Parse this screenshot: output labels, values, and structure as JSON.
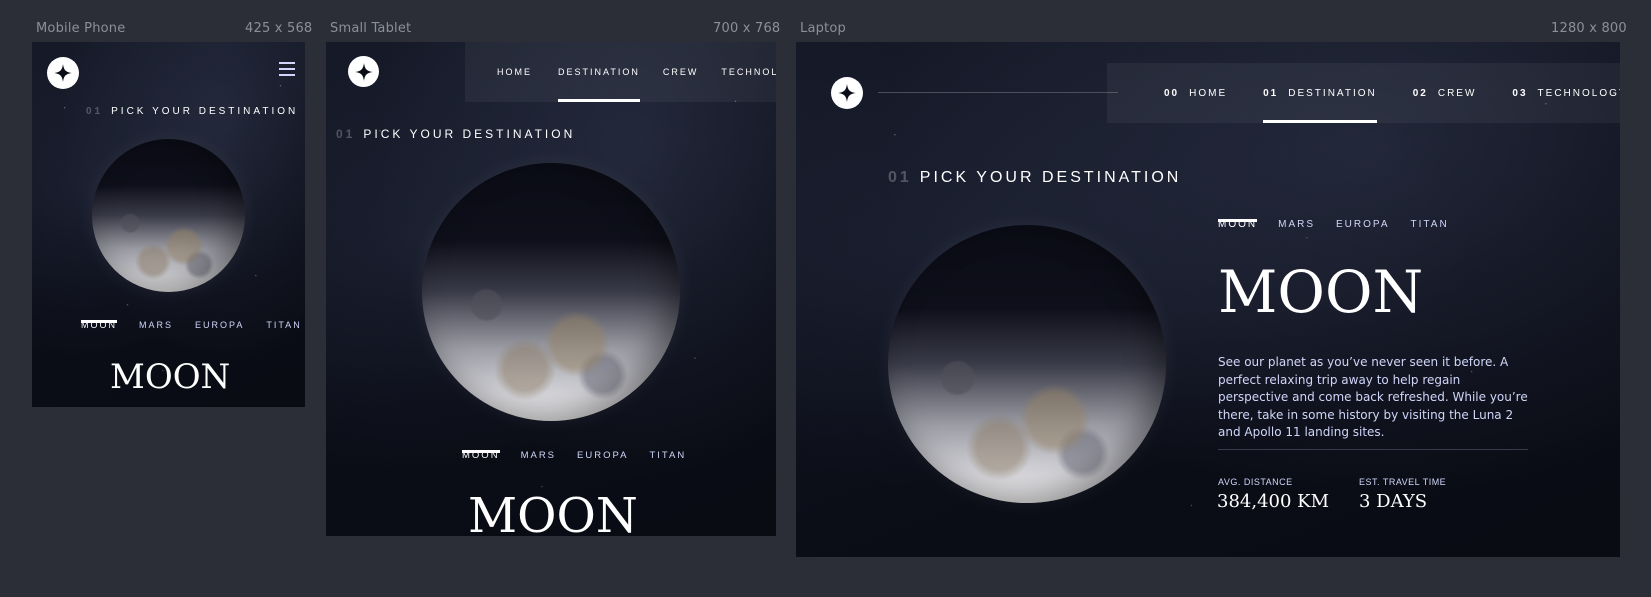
{
  "frames": {
    "mobile": {
      "label": "Mobile Phone",
      "size": "425 x 568"
    },
    "tablet": {
      "label": "Small Tablet",
      "size": "700 x 768"
    },
    "laptop": {
      "label": "Laptop",
      "size": "1280 x 800"
    }
  },
  "nav": {
    "items": [
      {
        "num": "00",
        "label": "HOME"
      },
      {
        "num": "01",
        "label": "DESTINATION"
      },
      {
        "num": "02",
        "label": "CREW"
      },
      {
        "num": "03",
        "label": "TECHNOLOGY"
      }
    ],
    "active_index": 1
  },
  "heading": {
    "num": "01",
    "text": "PICK YOUR DESTINATION"
  },
  "tabs": [
    "MOON",
    "MARS",
    "EUROPA",
    "TITAN"
  ],
  "destination": {
    "name": "MOON",
    "description": "See our planet as you’ve never seen it before. A perfect relaxing trip away to help regain perspective and come back refreshed. While you’re there, take in some history by visiting the Luna 2 and Apollo 11 landing sites.",
    "distance_label": "AVG. DISTANCE",
    "distance_value": "384,400 KM",
    "travel_label": "EST. TRAVEL TIME",
    "travel_value": "3 DAYS"
  },
  "colors": {
    "background": "#2b2e36",
    "space": "#0b0d17",
    "accent": "#d0d6f9",
    "white": "#ffffff"
  },
  "icons": {
    "logo": "star-logo-icon",
    "menu": "hamburger-menu-icon"
  }
}
